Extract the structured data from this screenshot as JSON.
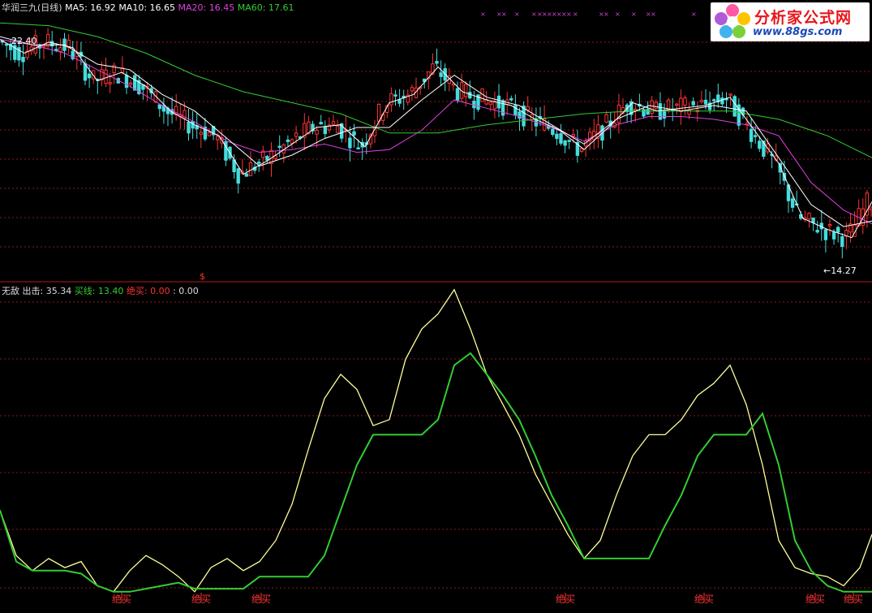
{
  "upper": {
    "name": "华润三九(日线)",
    "legend": [
      {
        "label": "MA5: 16.92",
        "color": "#ffffff"
      },
      {
        "label": "MA10: 16.65",
        "color": "#ffffff"
      },
      {
        "label": "MA20: 16.45",
        "color": "#e040e0"
      },
      {
        "label": "MA60: 17.61",
        "color": "#33cc33"
      }
    ],
    "high_label": "22.40",
    "low_label": "←14.27",
    "dollar": "$"
  },
  "lower": {
    "legend": [
      {
        "label": "无敌",
        "color": "#dddddd"
      },
      {
        "label": "出击: 35.34",
        "color": "#dddddd"
      },
      {
        "label": "买线: 13.40",
        "color": "#33cc33"
      },
      {
        "label": "绝买: 0.00",
        "color": "#ff3333"
      },
      {
        "label": ": 0.00",
        "color": "#dddddd"
      }
    ],
    "signal_label": "绝买"
  },
  "logo": {
    "title": "分析家公式网",
    "url": "www.88gs.com"
  },
  "colors": {
    "up": "#ff3333",
    "down": "#44dddd",
    "ma20": "#e040e0",
    "ma60": "#33cc33",
    "chuji": "#ffff99",
    "maixian": "#33cc33"
  },
  "chart_data": [
    {
      "type": "line",
      "title": "华润三九(日线)",
      "ylim": [
        13.8,
        23.0
      ],
      "annotations": [
        "22.40",
        "←14.27"
      ],
      "series": [
        {
          "name": "MA20",
          "x": [
            0,
            40,
            80,
            120,
            160,
            200,
            240,
            280,
            320,
            360,
            400,
            440,
            480,
            520,
            560,
            600,
            640,
            680,
            720,
            760,
            800,
            840,
            880,
            920,
            960,
            1000,
            1040,
            1075
          ],
          "y": [
            22.1,
            21.9,
            21.6,
            21.0,
            20.4,
            19.7,
            19.1,
            18.4,
            18.0,
            18.1,
            18.3,
            18.0,
            18.1,
            18.8,
            19.9,
            19.6,
            19.3,
            18.9,
            18.4,
            19.0,
            19.3,
            19.3,
            19.2,
            19.0,
            18.6,
            16.9,
            15.9,
            15.4
          ]
        },
        {
          "name": "MA60",
          "x": [
            0,
            60,
            120,
            180,
            240,
            300,
            360,
            420,
            480,
            540,
            600,
            660,
            720,
            780,
            840,
            900,
            960,
            1020,
            1075
          ],
          "y": [
            22.7,
            22.6,
            22.2,
            21.6,
            20.8,
            20.2,
            19.8,
            19.4,
            18.7,
            18.7,
            19.0,
            19.2,
            19.4,
            19.5,
            19.5,
            19.5,
            19.2,
            18.6,
            17.8
          ]
        },
        {
          "name": "MA5",
          "x": [
            0,
            30,
            60,
            90,
            120,
            150,
            180,
            210,
            240,
            270,
            300,
            330,
            360,
            390,
            420,
            450,
            480,
            510,
            540,
            570,
            600,
            630,
            660,
            690,
            720,
            750,
            780,
            810,
            840,
            870,
            900,
            930,
            960,
            990,
            1020,
            1050,
            1075
          ],
          "y": [
            22.1,
            21.6,
            22.0,
            21.8,
            20.6,
            20.9,
            20.4,
            19.5,
            19.0,
            18.6,
            17.2,
            17.7,
            18.3,
            18.9,
            19.0,
            18.2,
            19.8,
            20.1,
            21.1,
            20.2,
            19.9,
            19.7,
            19.2,
            18.8,
            18.1,
            18.9,
            19.8,
            19.5,
            19.6,
            19.7,
            20.0,
            18.8,
            17.6,
            15.6,
            15.2,
            14.9,
            16.2
          ]
        },
        {
          "name": "MA10",
          "x": [
            0,
            40,
            80,
            120,
            160,
            200,
            240,
            280,
            320,
            360,
            400,
            440,
            480,
            520,
            560,
            600,
            640,
            680,
            720,
            760,
            800,
            840,
            880,
            920,
            960,
            1000,
            1040,
            1075
          ],
          "y": [
            22.2,
            21.9,
            21.9,
            21.2,
            21.0,
            20.1,
            19.5,
            18.5,
            17.5,
            17.9,
            18.5,
            18.9,
            18.9,
            19.9,
            20.8,
            20.0,
            19.7,
            19.0,
            18.3,
            19.2,
            19.7,
            19.5,
            19.7,
            19.5,
            17.8,
            16.1,
            15.3,
            15.5
          ]
        }
      ]
    },
    {
      "type": "line",
      "title": "无敌",
      "ylim": [
        0,
        100
      ],
      "series": [
        {
          "name": "出击",
          "x": [
            0,
            20,
            40,
            60,
            80,
            100,
            120,
            140,
            160,
            180,
            200,
            220,
            240,
            260,
            280,
            300,
            320,
            340,
            360,
            380,
            400,
            420,
            440,
            460,
            480,
            500,
            520,
            540,
            560,
            580,
            600,
            620,
            640,
            660,
            680,
            700,
            720,
            740,
            760,
            780,
            800,
            820,
            840,
            860,
            880,
            900,
            920,
            940,
            960,
            980,
            1000,
            1020,
            1040,
            1060,
            1075
          ],
          "y": [
            30,
            15,
            10,
            14,
            11,
            13,
            5,
            3,
            10,
            15,
            12,
            8,
            3,
            11,
            14,
            10,
            13,
            20,
            32,
            50,
            67,
            75,
            70,
            58,
            60,
            80,
            90,
            95,
            103,
            90,
            75,
            65,
            55,
            42,
            32,
            22,
            14,
            20,
            35,
            48,
            55,
            55,
            60,
            68,
            72,
            78,
            65,
            45,
            20,
            11,
            9,
            8,
            5,
            11,
            22
          ]
        },
        {
          "name": "买线",
          "x": [
            0,
            20,
            40,
            60,
            80,
            100,
            120,
            140,
            160,
            180,
            200,
            220,
            240,
            260,
            280,
            300,
            320,
            340,
            360,
            380,
            400,
            420,
            440,
            460,
            480,
            500,
            520,
            540,
            560,
            580,
            600,
            620,
            640,
            660,
            680,
            700,
            720,
            740,
            760,
            780,
            800,
            820,
            840,
            860,
            880,
            900,
            920,
            940,
            960,
            980,
            1000,
            1020,
            1040,
            1060,
            1075
          ],
          "y": [
            30,
            13,
            10,
            10,
            10,
            9,
            5,
            3,
            3,
            4,
            5,
            6,
            4,
            4,
            4,
            4,
            8,
            8,
            8,
            8,
            15,
            30,
            45,
            55,
            55,
            55,
            55,
            60,
            78,
            82,
            75,
            68,
            60,
            48,
            35,
            25,
            14,
            14,
            14,
            14,
            14,
            25,
            35,
            48,
            55,
            55,
            55,
            62,
            45,
            20,
            10,
            5,
            3,
            3,
            3
          ]
        }
      ]
    }
  ]
}
